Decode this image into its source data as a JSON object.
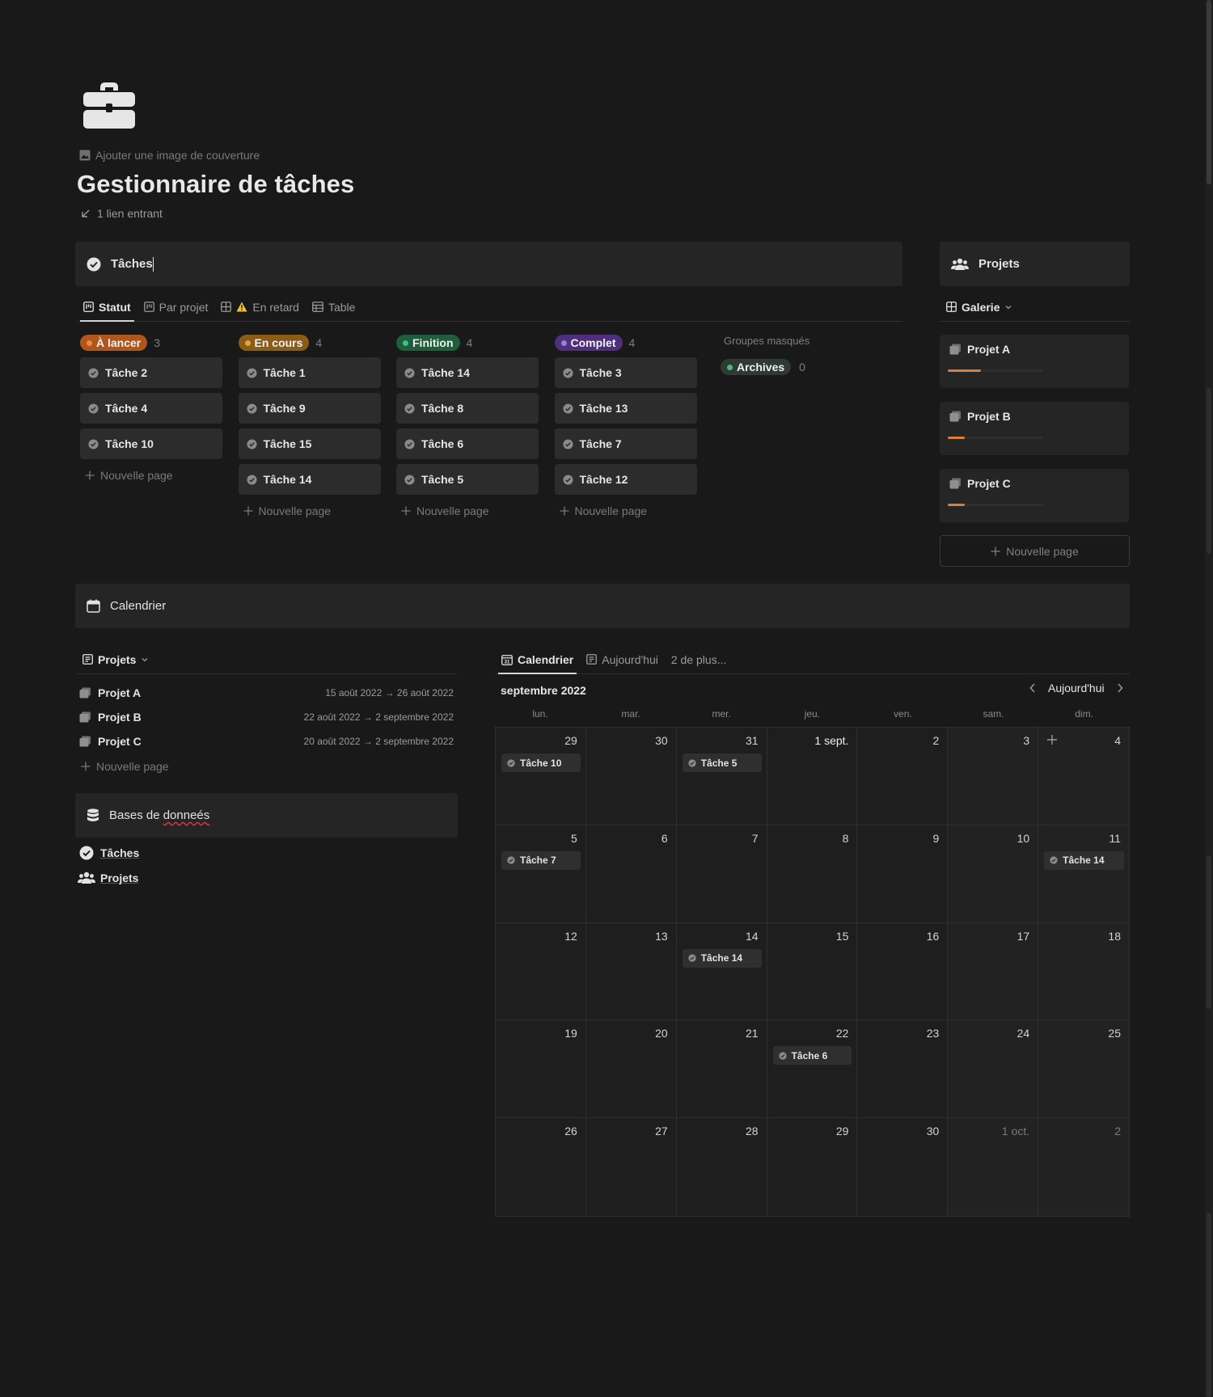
{
  "header": {
    "add_cover": "Ajouter une image de couverture",
    "title": "Gestionnaire de tâches",
    "backlink": "1 lien entrant"
  },
  "taches_db": {
    "title": "Tâches",
    "tabs": [
      "Statut",
      "Par projet",
      "En retard",
      "Table"
    ],
    "columns": [
      {
        "label": "À lancer",
        "count": "3",
        "color": "#b0561c",
        "dot": "#ef8a3d",
        "cards": [
          "Tâche 2",
          "Tâche 4",
          "Tâche 10"
        ]
      },
      {
        "label": "En cours",
        "count": "4",
        "color": "#8a5c16",
        "dot": "#e0a43a",
        "cards": [
          "Tâche 1",
          "Tâche 9",
          "Tâche 15",
          "Tâche 14"
        ]
      },
      {
        "label": "Finition",
        "count": "4",
        "color": "#1f5d3c",
        "dot": "#3fbf7a",
        "cards": [
          "Tâche 14",
          "Tâche 8",
          "Tâche 6",
          "Tâche 5"
        ]
      },
      {
        "label": "Complet",
        "count": "4",
        "color": "#4f2f7c",
        "dot": "#a07ad8",
        "cards": [
          "Tâche 3",
          "Tâche 13",
          "Tâche 7",
          "Tâche 12"
        ]
      }
    ],
    "new_page": "Nouvelle page",
    "hidden_groups": {
      "label": "Groupes masqués",
      "archives": "Archives",
      "archives_count": "0"
    }
  },
  "projets_db": {
    "title": "Projets",
    "view": "Galerie",
    "cards": [
      {
        "name": "Projet A",
        "progress": 0.35
      },
      {
        "name": "Projet B",
        "progress": 0.18
      },
      {
        "name": "Projet C",
        "progress": 0.18
      }
    ],
    "new_page": "Nouvelle page"
  },
  "calendrier_section": {
    "title": "Calendrier"
  },
  "projets_list": {
    "view": "Projets",
    "rows": [
      {
        "name": "Projet A",
        "dates": "15 août 2022 → 26 août 2022"
      },
      {
        "name": "Projet B",
        "dates": "22 août 2022 → 2 septembre 2022"
      },
      {
        "name": "Projet C",
        "dates": "20 août 2022 → 2 septembre 2022"
      }
    ],
    "new_page": "Nouvelle page"
  },
  "bases": {
    "title_a": "Bases de ",
    "title_b": "donneés",
    "items": [
      "Tâches",
      "Projets"
    ]
  },
  "calendar": {
    "tabs": [
      "Calendrier",
      "Aujourd'hui",
      "2 de plus..."
    ],
    "month": "septembre 2022",
    "today": "Aujourd'hui",
    "weekdays": [
      "lun.",
      "mar.",
      "mer.",
      "jeu.",
      "ven.",
      "sam.",
      "dim."
    ],
    "days": [
      {
        "n": "29",
        "m": false,
        "ev": "Tâche 10"
      },
      {
        "n": "30",
        "m": false
      },
      {
        "n": "31",
        "m": false,
        "ev": "Tâche 5"
      },
      {
        "n": "1 sept.",
        "m": false,
        "bold": true
      },
      {
        "n": "2",
        "m": false
      },
      {
        "n": "3",
        "m": false
      },
      {
        "n": "4",
        "m": false,
        "plus": true
      },
      {
        "n": "5",
        "m": false,
        "ev": "Tâche 7"
      },
      {
        "n": "6",
        "m": false
      },
      {
        "n": "7",
        "m": false
      },
      {
        "n": "8",
        "m": false
      },
      {
        "n": "9",
        "m": false
      },
      {
        "n": "10",
        "m": false
      },
      {
        "n": "11",
        "m": false,
        "ev": "Tâche 14"
      },
      {
        "n": "12",
        "m": false
      },
      {
        "n": "13",
        "m": false
      },
      {
        "n": "14",
        "m": false,
        "ev": "Tâche 14"
      },
      {
        "n": "15",
        "m": false
      },
      {
        "n": "16",
        "m": false
      },
      {
        "n": "17",
        "m": false
      },
      {
        "n": "18",
        "m": false
      },
      {
        "n": "19",
        "m": false
      },
      {
        "n": "20",
        "m": false
      },
      {
        "n": "21",
        "m": false
      },
      {
        "n": "22",
        "m": false,
        "ev": "Tâche 6"
      },
      {
        "n": "23",
        "m": false
      },
      {
        "n": "24",
        "m": false
      },
      {
        "n": "25",
        "m": false
      },
      {
        "n": "26",
        "m": false
      },
      {
        "n": "27",
        "m": false
      },
      {
        "n": "28",
        "m": false
      },
      {
        "n": "29",
        "m": false
      },
      {
        "n": "30",
        "m": false
      },
      {
        "n": "1 oct.",
        "m": true
      },
      {
        "n": "2",
        "m": true
      }
    ]
  }
}
